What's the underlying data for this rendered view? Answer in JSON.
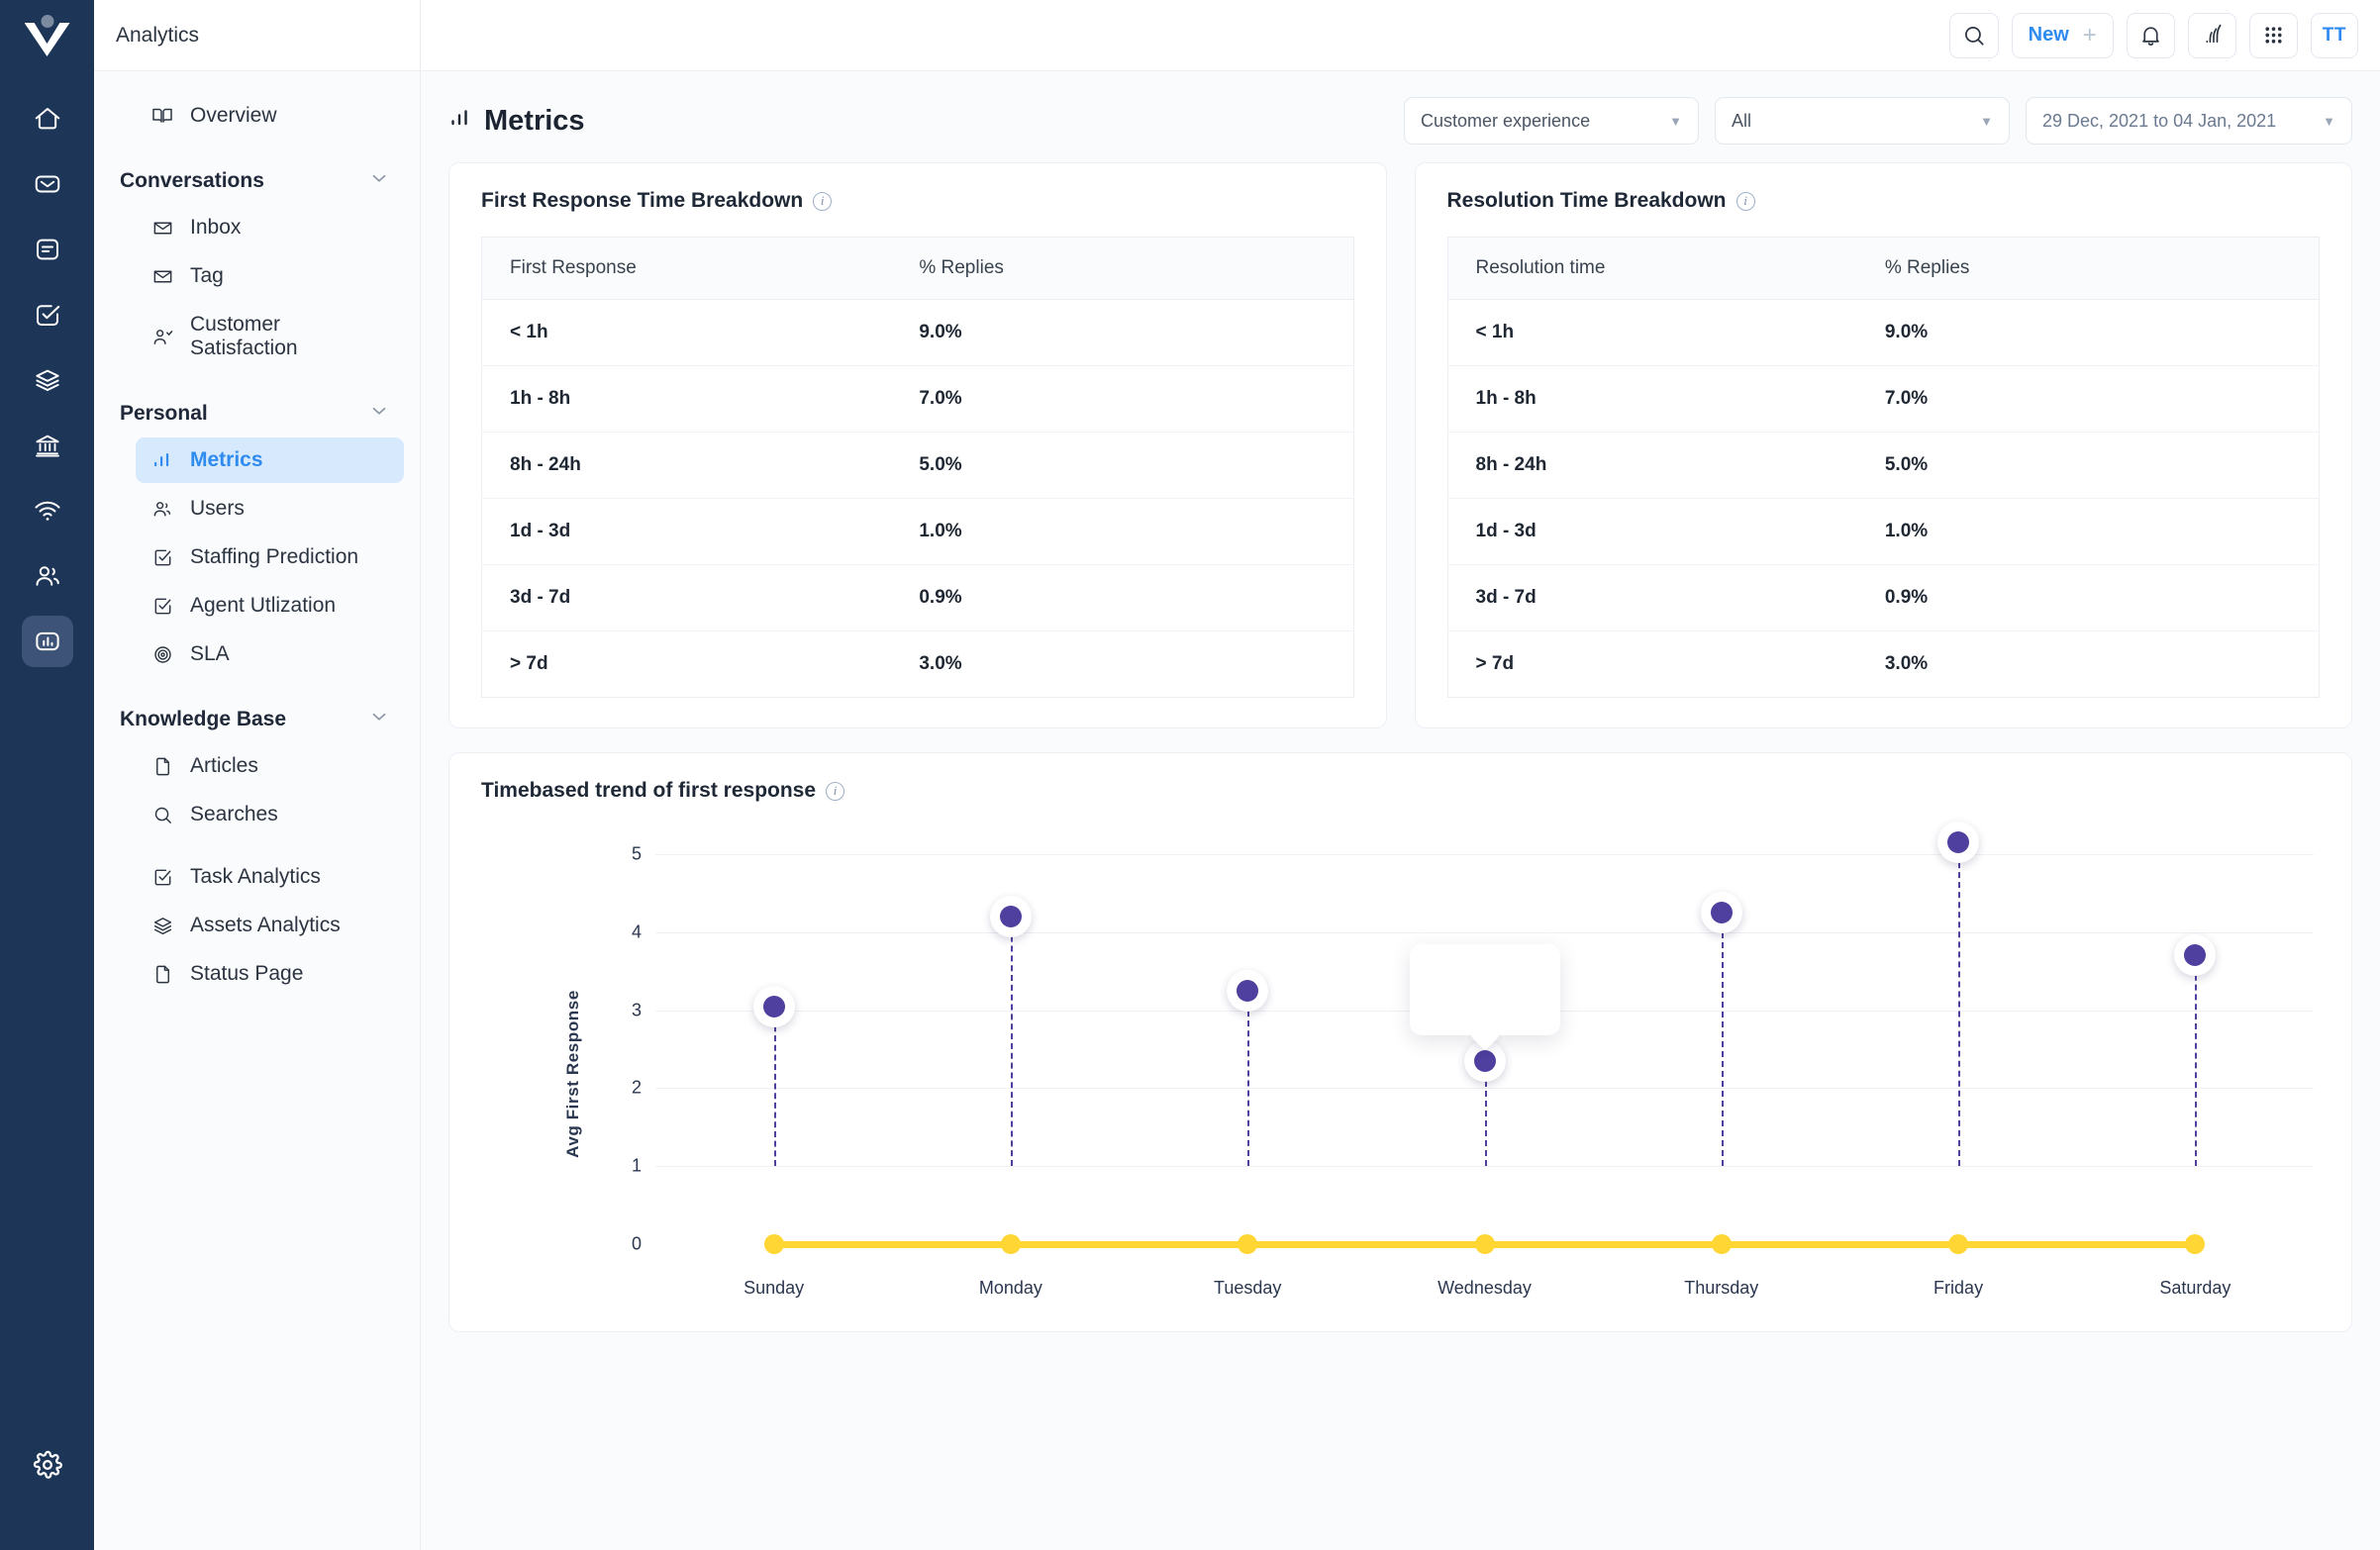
{
  "brand": {
    "logo_name": "vision-logo",
    "rail_bg": "#1d3557",
    "accent": "#2f8bef",
    "marker_color": "#4f3f9e",
    "baseline_color": "#ffd633"
  },
  "rail": {
    "items": [
      {
        "name": "home-icon",
        "label": "Home"
      },
      {
        "name": "envelope-icon",
        "label": "Mail"
      },
      {
        "name": "document-icon",
        "label": "Documents"
      },
      {
        "name": "checkbox-icon",
        "label": "Tasks"
      },
      {
        "name": "layers-icon",
        "label": "Assets"
      },
      {
        "name": "bank-icon",
        "label": "Finance"
      },
      {
        "name": "wifi-icon",
        "label": "Network"
      },
      {
        "name": "users-icon",
        "label": "Users"
      },
      {
        "name": "chart-icon",
        "label": "Analytics",
        "active": true
      }
    ],
    "settings_label": "Settings"
  },
  "nav": {
    "title": "Analytics",
    "overview": "Overview",
    "groups": [
      {
        "label": "Conversations",
        "items": [
          "Inbox",
          "Tag",
          "Customer Satisfaction"
        ]
      },
      {
        "label": "Personal",
        "items": [
          "Metrics",
          "Users",
          "Staffing  Prediction",
          "Agent Utlization",
          "SLA"
        ]
      },
      {
        "label": "Knowledge Base",
        "items": [
          "Articles",
          "Searches"
        ]
      }
    ],
    "extra_items": [
      "Task Analytics",
      "Assets Analytics",
      "Status Page"
    ],
    "active_item": "Metrics"
  },
  "topbar": {
    "search_label": "Search",
    "new_label": "New",
    "new_plus": "+",
    "bell_label": "Notifications",
    "broadcast_label": "Broadcast",
    "apps_label": "Apps",
    "avatar_initials": "TT"
  },
  "page": {
    "title": "Metrics",
    "filters": {
      "team": "Customer experience",
      "scope": "All",
      "date_range": "29 Dec, 2021 to 04 Jan, 2021"
    }
  },
  "cards": [
    {
      "title": "First Response Time Breakdown",
      "columns": [
        "First Response",
        "% Replies"
      ],
      "rows": [
        [
          "< 1h",
          "9.0%"
        ],
        [
          "1h - 8h",
          "7.0%"
        ],
        [
          "8h - 24h",
          "5.0%"
        ],
        [
          "1d - 3d",
          "1.0%"
        ],
        [
          "3d - 7d",
          "0.9%"
        ],
        [
          "> 7d",
          "3.0%"
        ]
      ]
    },
    {
      "title": "Resolution Time Breakdown",
      "columns": [
        "Resolution time",
        "% Replies"
      ],
      "rows": [
        [
          "< 1h",
          "9.0%"
        ],
        [
          "1h - 8h",
          "7.0%"
        ],
        [
          "8h - 24h",
          "5.0%"
        ],
        [
          "1d - 3d",
          "1.0%"
        ],
        [
          "3d - 7d",
          "0.9%"
        ],
        [
          "> 7d",
          "3.0%"
        ]
      ]
    }
  ],
  "chart_card": {
    "title": "Timebased trend of first response"
  },
  "chart_data": {
    "type": "scatter",
    "title": "Timebased trend of first response",
    "xlabel": "",
    "ylabel": "Avg First Response",
    "categories": [
      "Sunday",
      "Monday",
      "Tuesday",
      "Wednesday",
      "Thursday",
      "Friday",
      "Saturday"
    ],
    "yticks": [
      0,
      1,
      2,
      3,
      4,
      5
    ],
    "ylim": [
      0,
      5.6
    ],
    "grid": true,
    "legend": "none",
    "series": [
      {
        "name": "Avg First Response",
        "style": "lollipop",
        "color": "#4f3f9e",
        "stem_baseline": 1,
        "values": [
          3.05,
          4.2,
          3.25,
          2.35,
          4.25,
          5.15,
          3.7
        ]
      },
      {
        "name": "Baseline",
        "style": "line-markers",
        "color": "#ffd633",
        "values": [
          0,
          0,
          0,
          0,
          0,
          0,
          0
        ]
      }
    ],
    "tooltip": {
      "visible": true,
      "at_category": "Wednesday",
      "text": ""
    }
  }
}
